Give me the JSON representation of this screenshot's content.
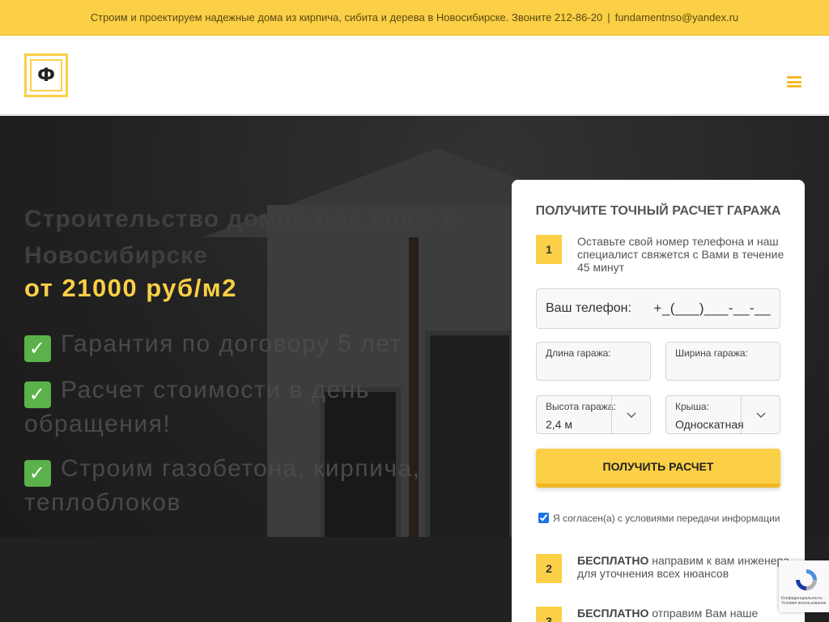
{
  "topbar": {
    "text": "Строим и проектируем надежные дома из кирпича, сибита и дерева в Новосибирске. Звоните 212-86-20",
    "separator": "|",
    "email": "fundamentnso@yandex.ru"
  },
  "header": {
    "logo_letter": "Ф",
    "menu_icon": "hamburger-menu-icon"
  },
  "hero": {
    "title": "Строительство домов под ключ в Новосибирске",
    "price": "от 21000 руб/м2",
    "features": [
      {
        "icon": "check-mark-icon",
        "text": "Гарантия по договору 5 лет"
      },
      {
        "icon": "check-mark-icon",
        "text": "Расчет стоимости в день обращения!"
      },
      {
        "icon": "check-mark-icon",
        "text": "Строим газобетона, кирпича, теплоблоков"
      }
    ]
  },
  "form": {
    "title": "ПОЛУЧИТЕ ТОЧНЫЙ РАСЧЕТ ГАРАЖА",
    "step1": {
      "num": "1",
      "text": "Оставьте свой номер телефона и наш специалист свяжется с Вами в течение 45 минут"
    },
    "phone": {
      "label": "Ваш телефон:",
      "value": "+_(___)___-__-__"
    },
    "length": {
      "label": "Длина гаража:",
      "value": ""
    },
    "width": {
      "label": "Ширина гаража:",
      "value": ""
    },
    "height": {
      "label": "Высота гаража:",
      "value": "2,4 м"
    },
    "roof": {
      "label": "Крыша:",
      "value": "Односкатная"
    },
    "submit_label": "ПОЛУЧИТЬ РАСЧЕТ",
    "consent": {
      "checked": true,
      "text": "Я согласен(а) с условиями передачи информации"
    },
    "step2": {
      "num": "2",
      "bold": "БЕСПЛАТНО",
      "text": " направим к вам инженера для уточнения всех нюансов"
    },
    "step3": {
      "num": "3",
      "bold": "БЕСПЛАТНО",
      "text": " отправим Вам наше"
    }
  },
  "recaptcha": {
    "text": "Конфиденциальность - Условия использования"
  },
  "colors": {
    "accent": "#fbcf46",
    "accent_dark": "#f2b71f",
    "check_green": "#5bb14a"
  }
}
